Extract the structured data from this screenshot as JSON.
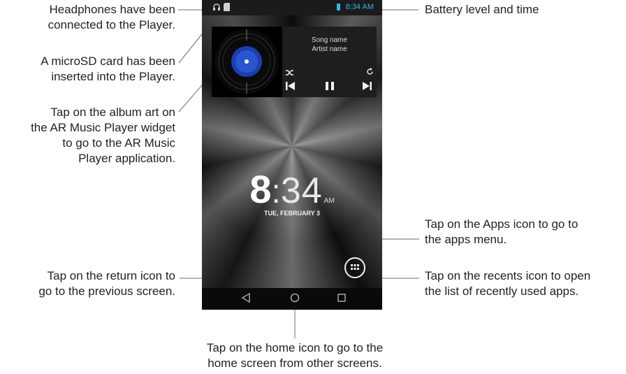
{
  "annotations": {
    "headphones": [
      "Headphones have been",
      "connected to the Player."
    ],
    "microsd": [
      "A microSD card has been",
      "inserted into the Player."
    ],
    "album_art": [
      "Tap on the album art on",
      "the AR Music Player widget",
      "to go to the AR Music",
      "Player application."
    ],
    "return": [
      "Tap on the return icon to",
      "go to the previous screen."
    ],
    "battery_time": "Battery level and time",
    "apps": [
      "Tap on the Apps icon to go to",
      "the apps menu."
    ],
    "recents": [
      "Tap on the recents icon to open",
      "the list of recently used apps."
    ],
    "home": [
      "Tap on the home icon to go to the",
      "home screen from other screens."
    ]
  },
  "status_bar": {
    "time": "8:34 AM",
    "accent_color": "#33b5e5"
  },
  "widget": {
    "song_name": "Song name",
    "artist_name": "Artist name"
  },
  "clock": {
    "hour": "8",
    "colon": ":",
    "minutes": "34",
    "ampm": "AM",
    "date": "TUE, FEBRUARY 3"
  },
  "icons": {
    "headphones": "headphones-icon",
    "sdcard": "sdcard-icon",
    "battery": "battery-icon",
    "shuffle": "shuffle-icon",
    "repeat": "repeat-icon",
    "previous": "previous-icon",
    "pause": "pause-icon",
    "next": "next-icon",
    "apps": "apps-grid-icon",
    "back": "back-icon",
    "home": "home-icon",
    "recents": "recents-icon"
  }
}
